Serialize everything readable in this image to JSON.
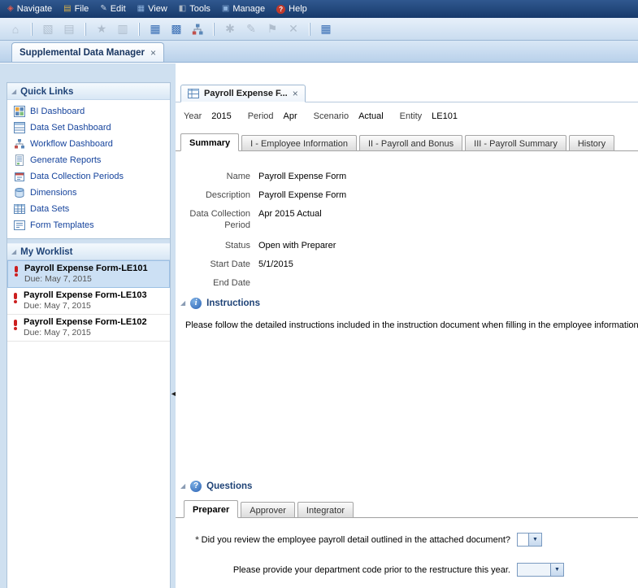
{
  "menubar": {
    "items": [
      "Navigate",
      "File",
      "Edit",
      "View",
      "Tools",
      "Manage",
      "Help"
    ]
  },
  "workspace_tab": {
    "label": "Supplemental Data Manager"
  },
  "quick_links": {
    "title": "Quick Links",
    "items": [
      {
        "label": "BI Dashboard"
      },
      {
        "label": "Data Set Dashboard"
      },
      {
        "label": "Workflow Dashboard"
      },
      {
        "label": "Generate Reports"
      },
      {
        "label": "Data Collection Periods"
      },
      {
        "label": "Dimensions"
      },
      {
        "label": "Data Sets"
      },
      {
        "label": "Form Templates"
      }
    ]
  },
  "worklist": {
    "title": "My Worklist",
    "items": [
      {
        "title": "Payroll Expense Form-LE101",
        "due": "Due: May 7, 2015",
        "selected": true
      },
      {
        "title": "Payroll Expense Form-LE103",
        "due": "Due: May 7, 2015",
        "selected": false
      },
      {
        "title": "Payroll Expense Form-LE102",
        "due": "Due: May 7, 2015",
        "selected": false
      }
    ]
  },
  "form_tab": {
    "label": "Payroll Expense F..."
  },
  "pov": {
    "pairs": [
      {
        "label": "Year",
        "value": "2015"
      },
      {
        "label": "Period",
        "value": "Apr"
      },
      {
        "label": "Scenario",
        "value": "Actual"
      },
      {
        "label": "Entity",
        "value": "LE101"
      }
    ]
  },
  "form_tabs": [
    "Summary",
    "I - Employee Information",
    "II - Payroll and Bonus",
    "III - Payroll Summary",
    "History"
  ],
  "summary": {
    "fields": [
      {
        "label": "Name",
        "value": "Payroll Expense Form"
      },
      {
        "label": "Description",
        "value": "Payroll Expense Form"
      },
      {
        "label": "Data Collection Period",
        "value": "Apr 2015 Actual"
      },
      {
        "label": "Status",
        "value": "Open with Preparer"
      },
      {
        "label": "Start Date",
        "value": "5/1/2015"
      },
      {
        "label": "End Date",
        "value": ""
      }
    ]
  },
  "instructions": {
    "title": "Instructions",
    "text": "Please follow the detailed instructions included in the instruction document when filling in the employee information."
  },
  "questions": {
    "title": "Questions",
    "tabs": [
      "Preparer",
      "Approver",
      "Integrator"
    ],
    "items": [
      {
        "required": "*",
        "text": "Did you review the employee payroll detail outlined in the attached document?"
      },
      {
        "required": "",
        "text": "Please provide your department code prior to the restructure this year."
      }
    ]
  },
  "icons": {
    "close": "×",
    "disclosure": "◢",
    "collapse_left": "◄",
    "dropdown": "▼",
    "info": "i",
    "question": "?",
    "menu_navigate": "◈",
    "menu_file": "▤",
    "menu_edit": "✎",
    "menu_view": "▦",
    "menu_tools": "◧",
    "menu_manage": "▣",
    "menu_help": "?",
    "home": "⌂",
    "explore": "▧",
    "documents": "▤",
    "favorites": "★",
    "print": "▥",
    "bi_grid": "▦",
    "window_grid": "▩",
    "new_doc": "✱",
    "edit": "✎",
    "flag": "⚑",
    "delete": "✕",
    "table": "▦"
  }
}
